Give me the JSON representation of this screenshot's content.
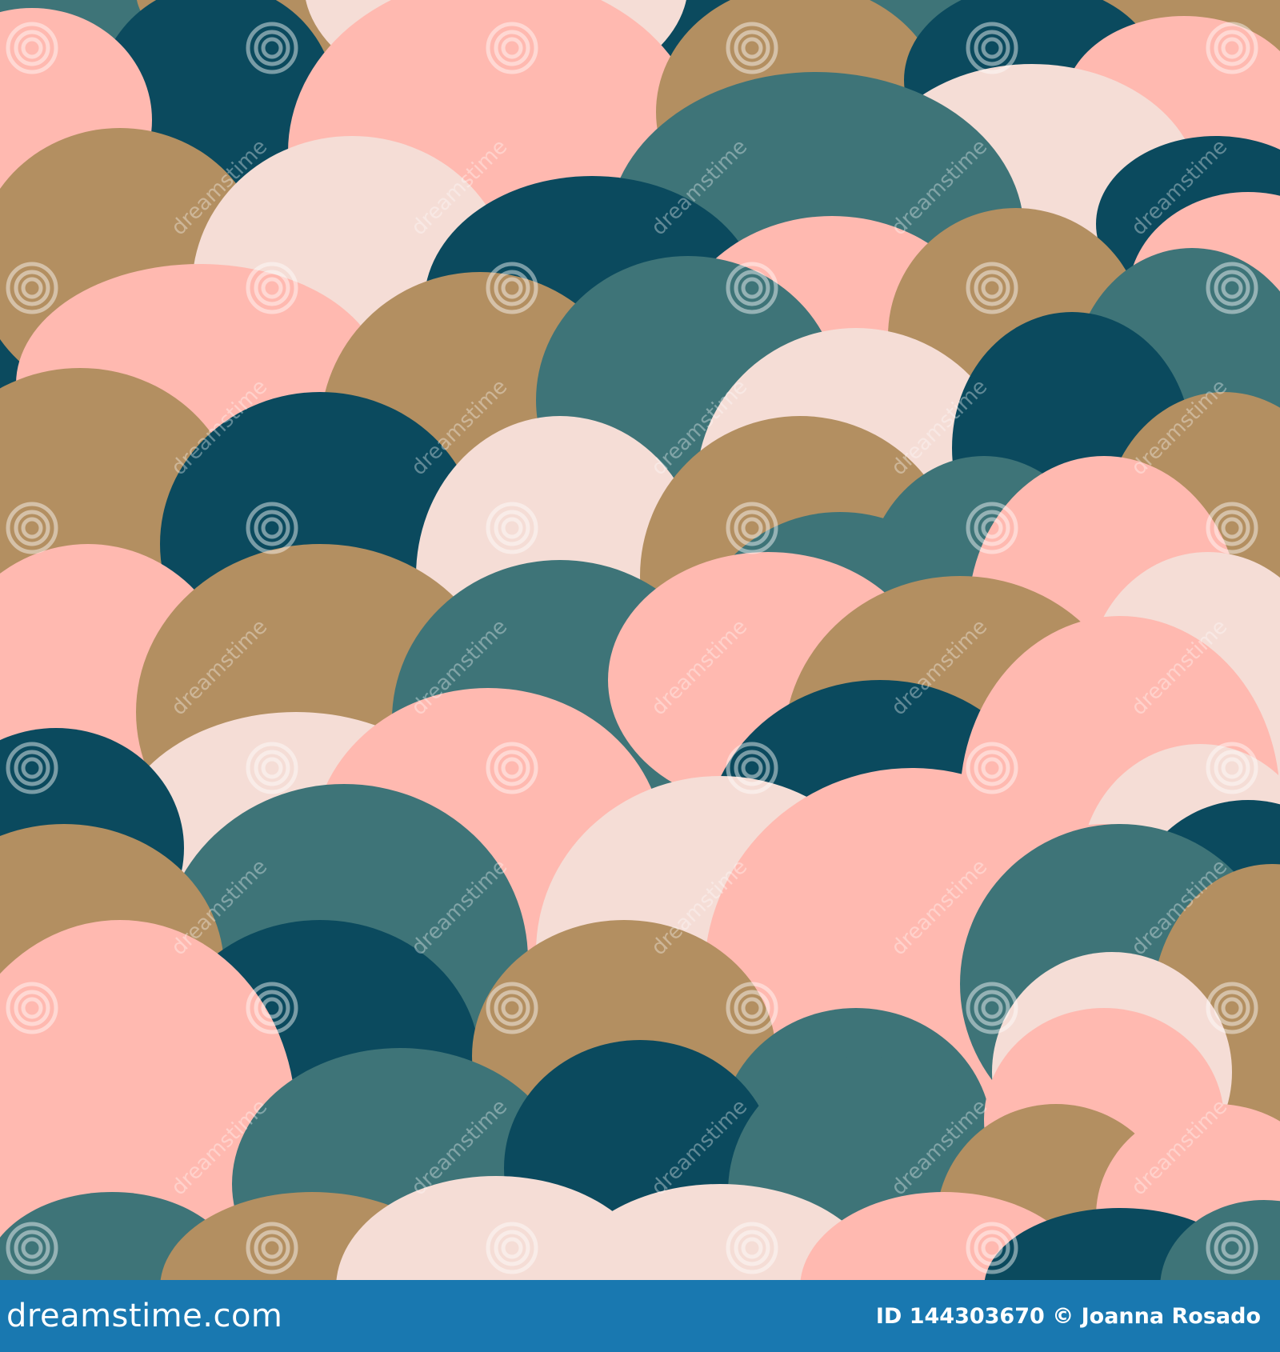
{
  "colors": {
    "dark_teal": "#0b4a5e",
    "teal": "#3e7478",
    "gold": "#b38f61",
    "pink": "#ffb9b0",
    "light_pink": "#f5ddd6",
    "footer_bg": "#1978b0",
    "watermark": "#ffffff"
  },
  "watermark": {
    "text": "dreamstime",
    "icon": "spiral-icon"
  },
  "footer": {
    "brand": "dreamstime.com",
    "id_label": "ID",
    "id_value": "144303670",
    "copyright": "©",
    "author": "Joanna Rosado"
  }
}
